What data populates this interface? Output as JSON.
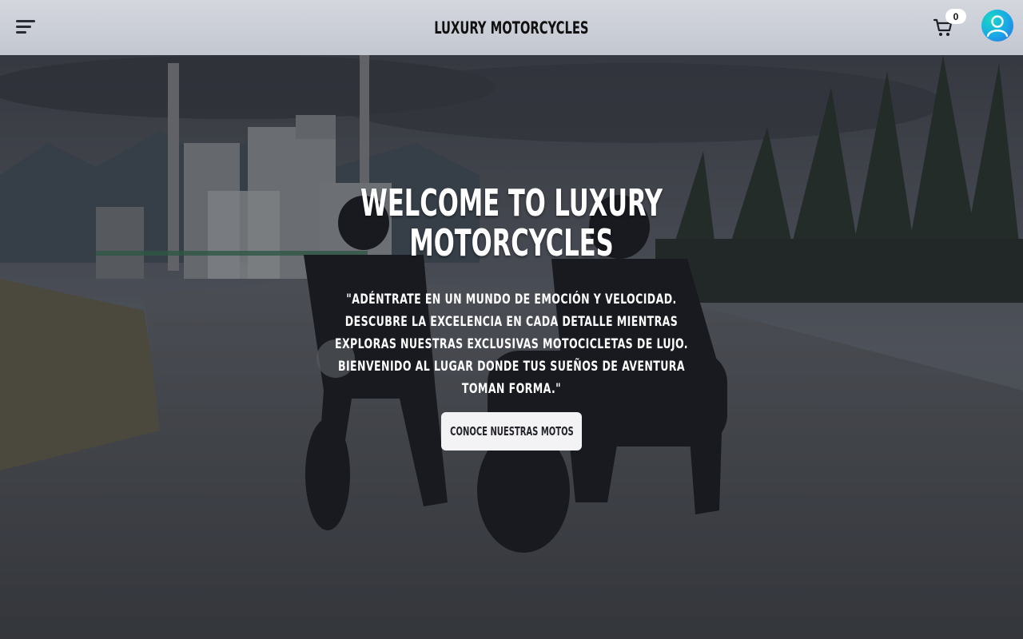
{
  "header": {
    "brand": "LUXURY MOTORCYCLES",
    "cart_count": "0",
    "menu_icon": "hamburger-menu-icon",
    "cart_icon": "shopping-cart-icon",
    "avatar_icon": "user-avatar-icon"
  },
  "hero": {
    "title_line1": "WELCOME TO LUXURY",
    "title_line2": "MOTORCYCLES",
    "text": "\"Adéntrate en un mundo de emoción y velocidad. Descubre la excelencia en cada detalle mientras exploras nuestras exclusivas motocicletas de lujo. Bienvenido al lugar donde tus sueños de aventura toman forma.\"",
    "cta_label": "Conoce nuestras motos"
  },
  "colors": {
    "header_bg": "#c9ccd4",
    "avatar_accent": "#1aa7e8",
    "button_bg": "#f3f3f5"
  }
}
